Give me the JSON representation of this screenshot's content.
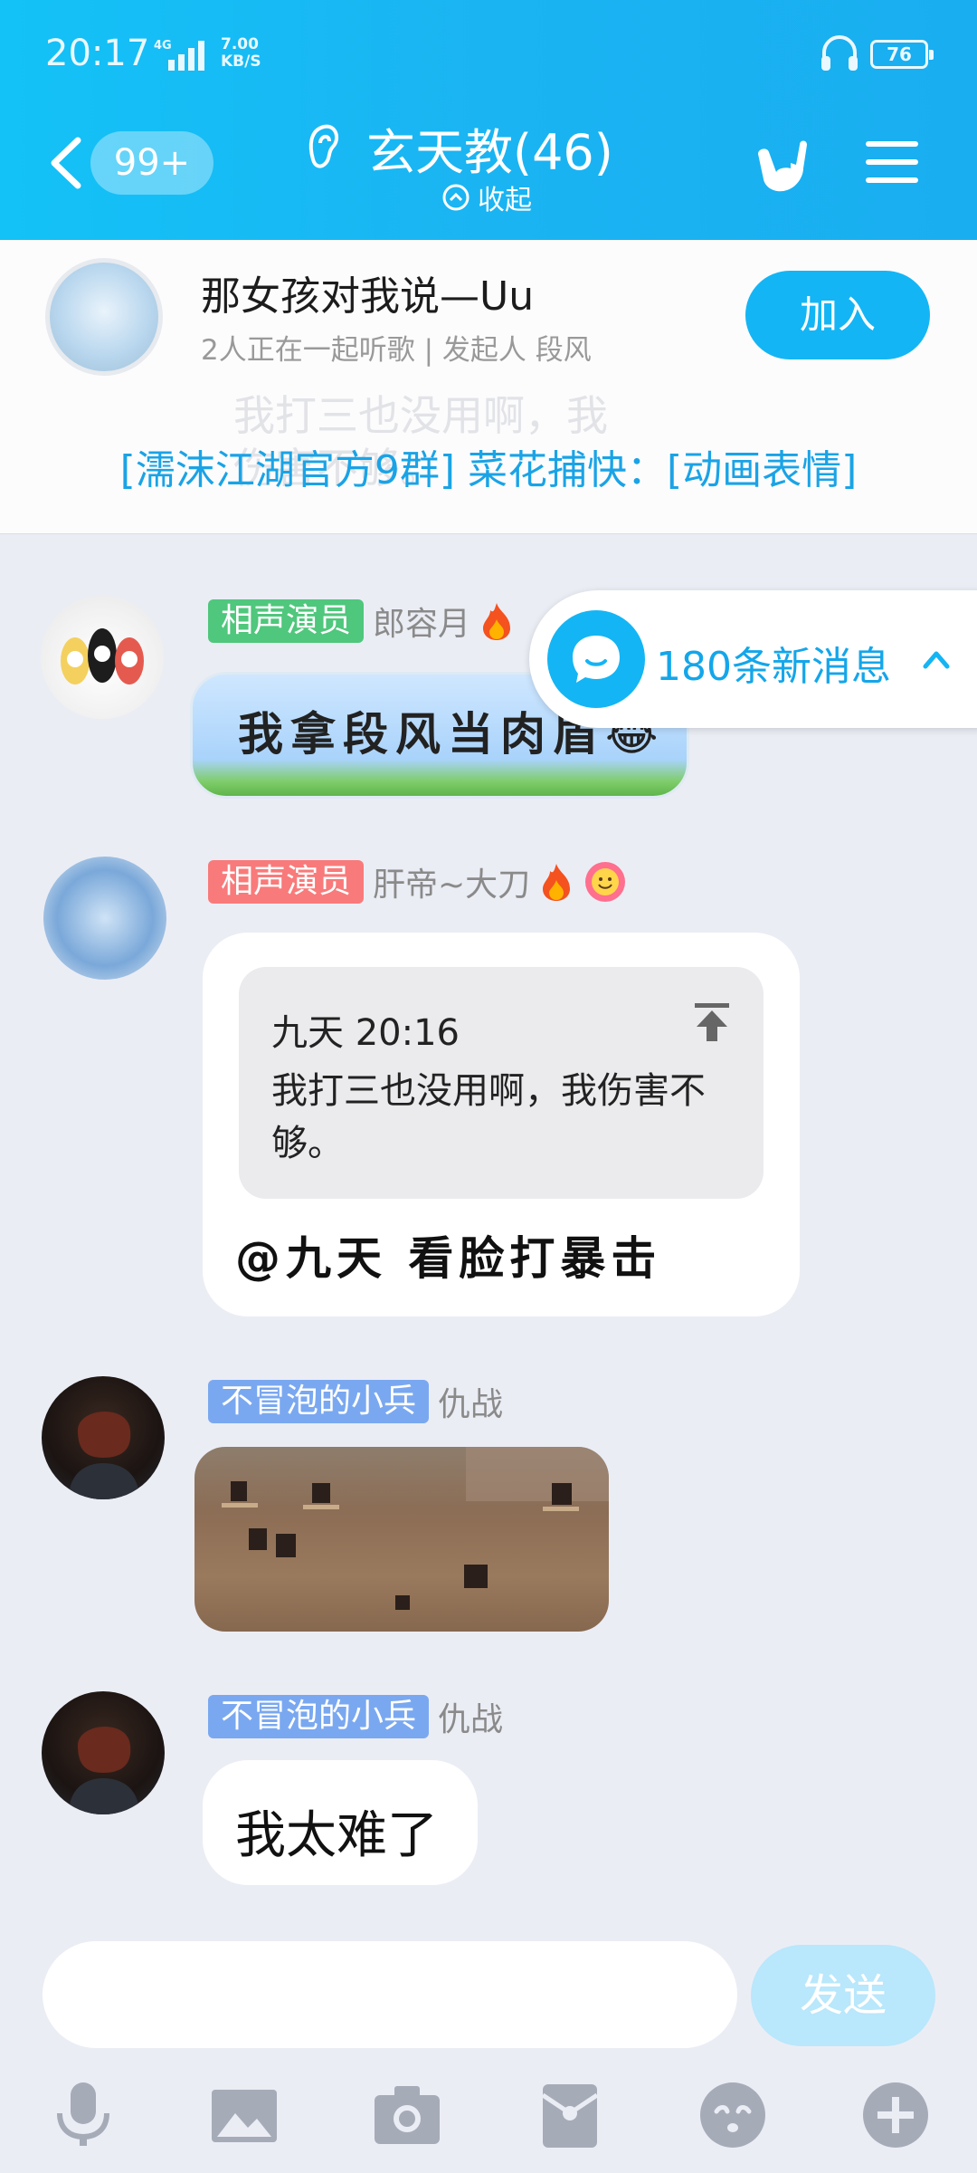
{
  "status_bar": {
    "time": "20:17",
    "network": "4G",
    "speed_value": "7.00",
    "speed_unit": "KB/S",
    "battery": "76"
  },
  "header": {
    "unread_badge": "99+",
    "title": "玄天教(46)",
    "collapse_label": "收起"
  },
  "music": {
    "song_title": "那女孩对我说—Uu",
    "subtitle": "2人正在一起听歌 | 发起人 段风",
    "join_label": "加入",
    "ghost_line_1": "我打三也没用啊，我",
    "ghost_line_2": "伤害不够。",
    "announcement": "[濡沫江湖官方9群] 菜花捕快：[动画表情]"
  },
  "new_messages": {
    "label": "180条新消息"
  },
  "messages": [
    {
      "tag": "相声演员",
      "sender": "郎容月",
      "sticker_text": "我拿段风当肉盾😂"
    },
    {
      "tag": "相声演员",
      "sender": "肝帝~大刀",
      "quote_header": "九天 20:16",
      "quote_body": "我打三也没用啊，我伤害不够。",
      "text": "@九天 看脸打暴击"
    },
    {
      "tag": "不冒泡的小兵",
      "sender": "仇战"
    },
    {
      "tag": "不冒泡的小兵",
      "sender": "仇战",
      "text": "我太难了"
    }
  ],
  "input": {
    "placeholder": "",
    "send_label": "发送"
  },
  "toolbar": [
    "mic-icon",
    "image-icon",
    "camera-icon",
    "red-packet-icon",
    "emoji-icon",
    "plus-icon"
  ],
  "colors": {
    "header_blue": "#13c2f7",
    "accent_blue": "#14b5f4",
    "link_blue": "#1aa3e6",
    "tag_green": "#4fc77c",
    "tag_pink": "#f97a7a",
    "tag_blue": "#7aa8f0",
    "background": "#ebedf5"
  }
}
